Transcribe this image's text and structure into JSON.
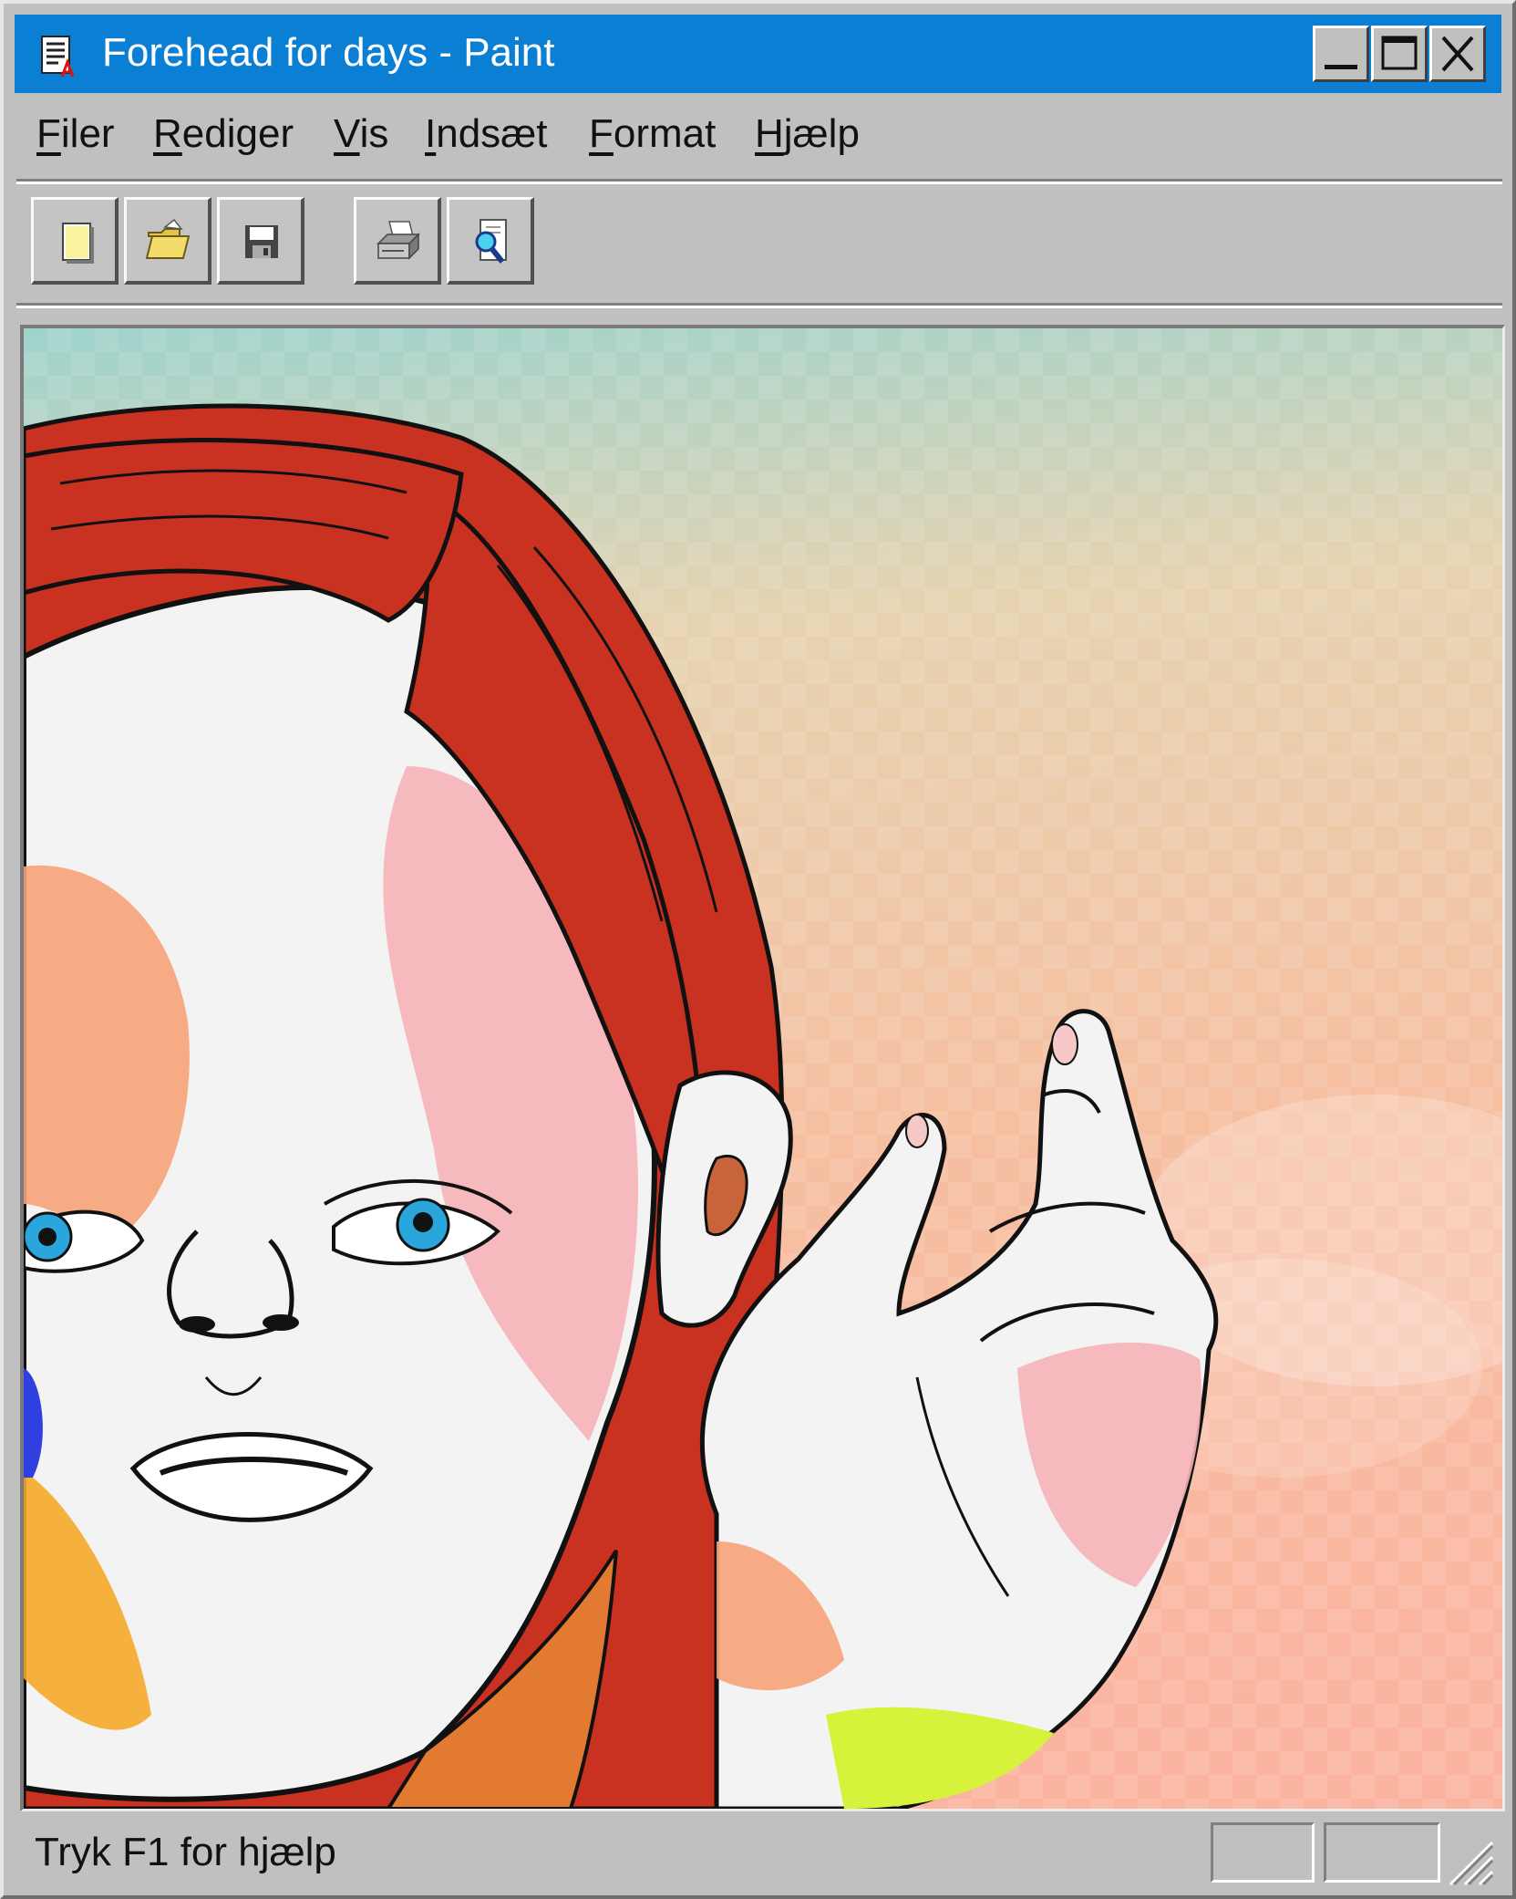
{
  "window": {
    "title": "Forehead for days - Paint",
    "app_icon": "paint-document-icon",
    "controls": [
      "minimize-icon",
      "maximize-icon",
      "close-icon"
    ]
  },
  "menubar": {
    "items": [
      {
        "mnemonic": "F",
        "rest": "iler"
      },
      {
        "mnemonic": "R",
        "rest": "ediger"
      },
      {
        "mnemonic": "V",
        "rest": "is"
      },
      {
        "mnemonic": "I",
        "rest": "ndsæt"
      },
      {
        "mnemonic": "F",
        "rest": "ormat"
      },
      {
        "mnemonic": "H",
        "rest": "jælp"
      }
    ]
  },
  "toolbar": {
    "buttons": [
      "new-document-icon",
      "open-folder-icon",
      "save-disk-icon",
      "print-icon",
      "print-preview-icon"
    ]
  },
  "canvas": {
    "content": "illustration",
    "colors": {
      "hair": "#c9301e",
      "skin": "#f2f2f2",
      "blush": "#f6b1b6",
      "eye": "#2aa6dc",
      "outline": "#111111"
    }
  },
  "statusbar": {
    "text": "Tryk F1 for hjælp"
  }
}
